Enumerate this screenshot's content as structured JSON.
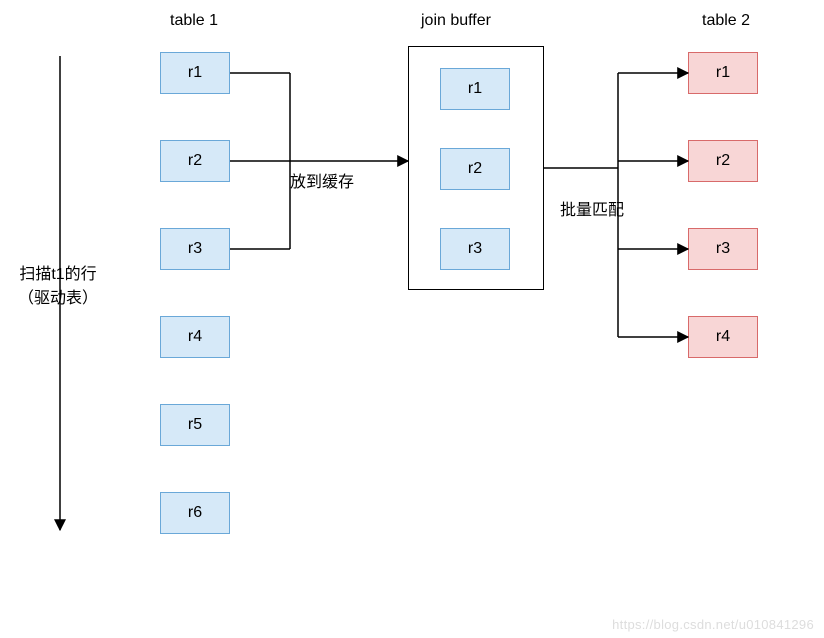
{
  "labels": {
    "table1": "table 1",
    "join_buffer": "join buffer",
    "table2": "table 2",
    "scan_caption_line1": "扫描t1的行",
    "scan_caption_line2": "（驱动表）",
    "put_to_cache": "放到缓存",
    "batch_match": "批量匹配"
  },
  "table1_rows": [
    "r1",
    "r2",
    "r3",
    "r4",
    "r5",
    "r6"
  ],
  "buffer_rows": [
    "r1",
    "r2",
    "r3"
  ],
  "table2_rows": [
    "r1",
    "r2",
    "r3",
    "r4"
  ],
  "watermark": "https://blog.csdn.net/u010841296"
}
